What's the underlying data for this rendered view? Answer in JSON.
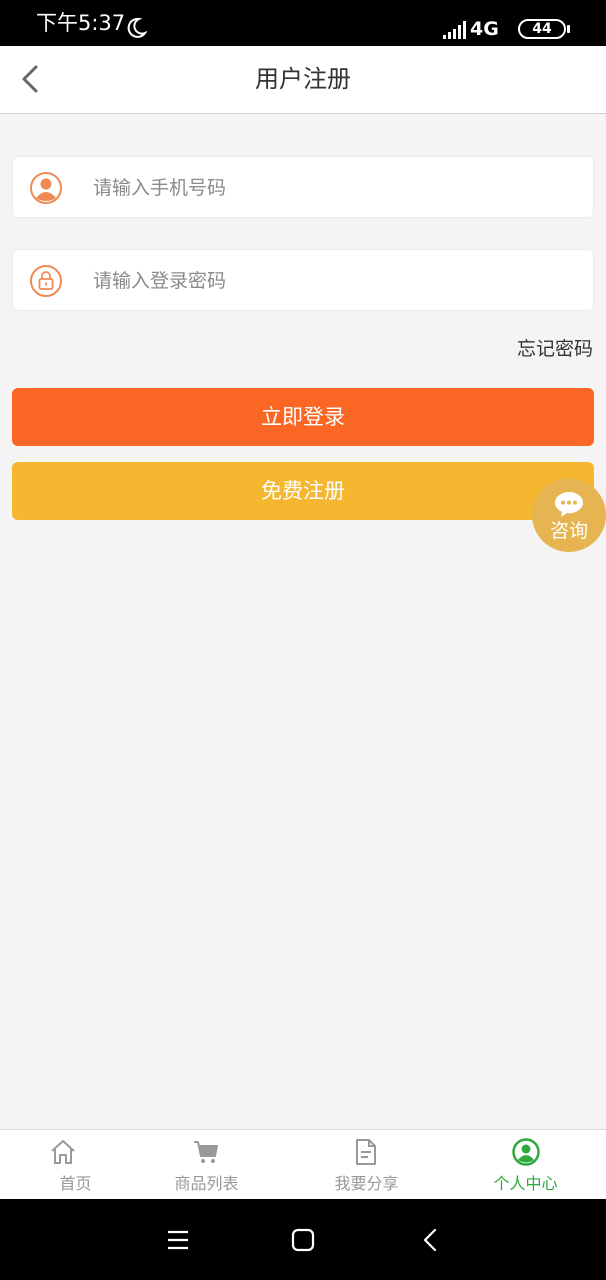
{
  "status_bar": {
    "time": "下午5:37",
    "network": "4G",
    "battery": "44",
    "icons": [
      "moon-icon",
      "signal-icon"
    ]
  },
  "header": {
    "title": "用户注册",
    "back_icon": "chevron-left-icon"
  },
  "form": {
    "phone": {
      "placeholder": "请输入手机号码",
      "value": "",
      "icon": "user-icon"
    },
    "password": {
      "placeholder": "请输入登录密码",
      "value": "",
      "icon": "lock-icon"
    },
    "forgot_label": "忘记密码",
    "login_label": "立即登录",
    "register_label": "免费注册"
  },
  "consult": {
    "label": "咨询",
    "icon": "chat-bubble-icon"
  },
  "bottom_nav": {
    "items": [
      {
        "label": "首页",
        "icon": "home-icon",
        "active": false
      },
      {
        "label": "商品列表",
        "icon": "cart-icon",
        "active": false
      },
      {
        "label": "我要分享",
        "icon": "document-icon",
        "active": false
      },
      {
        "label": "个人中心",
        "icon": "user-circle-icon",
        "active": true
      }
    ]
  },
  "colors": {
    "accent_orange": "#fa6724",
    "accent_yellow": "#f5b630",
    "consult_bg": "#e6b450",
    "icon_orange": "#f08a55",
    "active_green": "#2ea93b",
    "background": "#f4f4f4"
  }
}
